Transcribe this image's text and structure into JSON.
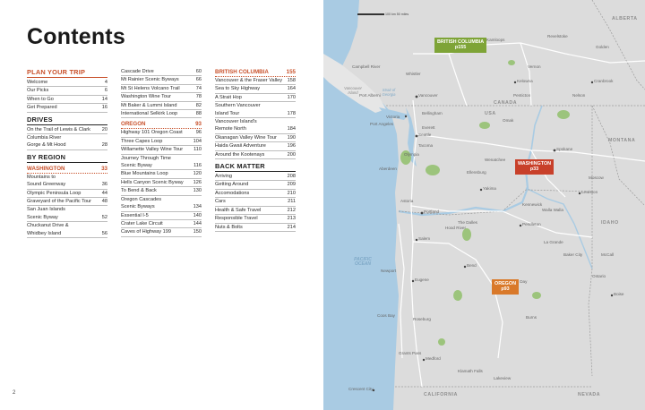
{
  "page_title": "Contents",
  "page_number": "2",
  "toc": {
    "col1": [
      {
        "kind": "section",
        "label": "PLAN YOUR TRIP",
        "page": ""
      },
      {
        "kind": "entry",
        "label": "Welcome",
        "page": "4"
      },
      {
        "kind": "entry",
        "label": "Our Picks",
        "page": "6"
      },
      {
        "kind": "entry",
        "label": "When to Go",
        "page": "14"
      },
      {
        "kind": "entry",
        "label": "Get Prepared",
        "page": "16"
      },
      {
        "kind": "section-dark",
        "label": "DRIVES",
        "page": ""
      },
      {
        "kind": "entry",
        "label": "On the Trail of Lewis & Clark",
        "page": "20"
      },
      {
        "kind": "wrap",
        "label": "Columbia River",
        "page": ""
      },
      {
        "kind": "entry",
        "label": "Gorge & Mt Hood",
        "page": "28"
      },
      {
        "kind": "section-dark",
        "label": "BY REGION",
        "page": ""
      },
      {
        "kind": "sub",
        "label": "WASHINGTON",
        "page": "33"
      },
      {
        "kind": "wrap",
        "label": "Mountains to",
        "page": ""
      },
      {
        "kind": "entry",
        "label": "Sound Greenway",
        "page": "36"
      },
      {
        "kind": "entry",
        "label": "Olympic Peninsula Loop",
        "page": "44"
      },
      {
        "kind": "entry",
        "label": "Graveyard of the Pacific Tour",
        "page": "48"
      },
      {
        "kind": "wrap",
        "label": "San Juan Islands",
        "page": ""
      },
      {
        "kind": "entry",
        "label": "Scenic Byway",
        "page": "52"
      },
      {
        "kind": "wrap",
        "label": "Chuckanut Drive &",
        "page": ""
      },
      {
        "kind": "entry",
        "label": "Whidbey Island",
        "page": "56"
      }
    ],
    "col2": [
      {
        "kind": "entry",
        "label": "Cascade Drive",
        "page": "60"
      },
      {
        "kind": "entry",
        "label": "Mt Rainier Scenic Byways",
        "page": "66"
      },
      {
        "kind": "entry",
        "label": "Mt St Helens Volcano Trail",
        "page": "74"
      },
      {
        "kind": "entry",
        "label": "Washington Wine Tour",
        "page": "78"
      },
      {
        "kind": "entry",
        "label": "Mt Baker & Lummi Island",
        "page": "82"
      },
      {
        "kind": "entry",
        "label": "International Selkirk Loop",
        "page": "88"
      },
      {
        "kind": "sub",
        "label": "OREGON",
        "page": "93"
      },
      {
        "kind": "entry",
        "label": "Highway 101 Oregon Coast",
        "page": "96"
      },
      {
        "kind": "entry",
        "label": "Three Capes Loop",
        "page": "104"
      },
      {
        "kind": "entry",
        "label": "Willamette Valley Wine Tour",
        "page": "110"
      },
      {
        "kind": "wrap",
        "label": "Journey Through Time",
        "page": ""
      },
      {
        "kind": "entry",
        "label": "Scenic Byway",
        "page": "116"
      },
      {
        "kind": "entry",
        "label": "Blue Mountains Loop",
        "page": "120"
      },
      {
        "kind": "entry",
        "label": "Hells Canyon Scenic Byway",
        "page": "126"
      },
      {
        "kind": "entry",
        "label": "To Bend & Back",
        "page": "130"
      },
      {
        "kind": "wrap",
        "label": "Oregon Cascades",
        "page": ""
      },
      {
        "kind": "entry",
        "label": "Scenic Byways",
        "page": "134"
      },
      {
        "kind": "entry",
        "label": "Essential I-5",
        "page": "140"
      },
      {
        "kind": "entry",
        "label": "Crater Lake Circuit",
        "page": "144"
      },
      {
        "kind": "entry",
        "label": "Caves of Highway 199",
        "page": "150"
      }
    ],
    "col3": [
      {
        "kind": "sub",
        "label": "BRITISH COLUMBIA",
        "page": "155"
      },
      {
        "kind": "entry",
        "label": "Vancouver & the Fraser Valley",
        "page": "158"
      },
      {
        "kind": "entry",
        "label": "Sea to Sky Highway",
        "page": "164"
      },
      {
        "kind": "entry",
        "label": "A Strait Hop",
        "page": "170"
      },
      {
        "kind": "wrap",
        "label": "Southern Vancouver",
        "page": ""
      },
      {
        "kind": "entry",
        "label": "Island Tour",
        "page": "178"
      },
      {
        "kind": "wrap",
        "label": "Vancouver Island's",
        "page": ""
      },
      {
        "kind": "entry",
        "label": "Remote North",
        "page": "184"
      },
      {
        "kind": "entry",
        "label": "Okanagan Valley Wine Tour",
        "page": "190"
      },
      {
        "kind": "entry",
        "label": "Haida Gwaii Adventure",
        "page": "196"
      },
      {
        "kind": "entry",
        "label": "Around the Kootenays",
        "page": "200"
      },
      {
        "kind": "section-dark",
        "label": "BACK MATTER",
        "page": ""
      },
      {
        "kind": "entry",
        "label": "Arriving",
        "page": "208"
      },
      {
        "kind": "entry",
        "label": "Getting Around",
        "page": "209"
      },
      {
        "kind": "entry",
        "label": "Accomodations",
        "page": "210"
      },
      {
        "kind": "entry",
        "label": "Cars",
        "page": "211"
      },
      {
        "kind": "entry",
        "label": "Health & Safe Travel",
        "page": "212"
      },
      {
        "kind": "entry",
        "label": "Responsible Travel",
        "page": "213"
      },
      {
        "kind": "entry",
        "label": "Nuts & Bolts",
        "page": "214"
      }
    ]
  },
  "map": {
    "scale": {
      "km": "100 km",
      "mi": "50 miles"
    },
    "badges": {
      "bc": {
        "name": "BRITISH COLUMBIA",
        "page": "p155"
      },
      "wa": {
        "name": "WASHINGTON",
        "page": "p33"
      },
      "or": {
        "name": "OREGON",
        "page": "p93"
      }
    },
    "regions": {
      "alberta": "ALBERTA",
      "montana": "MONTANA",
      "idaho": "IDAHO",
      "california": "CALIFORNIA",
      "nevada": "NEVADA",
      "canada": "CANADA",
      "usa": "USA"
    },
    "water": {
      "pacific": "PACIFIC\nOCEAN",
      "vancouver_island": "Vancouver\nIsland",
      "strait": "Strait of\nGeorgia"
    },
    "places": {
      "kamloops": "Kamloops",
      "kelowna": "Kelowna",
      "vancouver": "Vancouver",
      "victoria": "Victoria",
      "seattle": "Seattle",
      "spokane": "Spokane",
      "yakima": "Yakima",
      "portland": "Portland",
      "salem": "Salem",
      "eugene": "Eugene",
      "bend": "Bend",
      "medford": "Medford",
      "pendleton": "Pendleton",
      "lewiston": "Lewiston",
      "boise": "Boise",
      "cranbrook": "Cranbrook",
      "crescent_city": "Crescent City",
      "tacoma": "Tacoma",
      "olympia": "Olympia",
      "astoria": "Astoria",
      "newport": "Newport",
      "coos_bay": "Coos Bay",
      "klamath_falls": "Klamath Falls",
      "burns": "Burns",
      "walla_walla": "Walla Walla",
      "wenatchee": "Wenatchee",
      "kennewick": "Kennewick",
      "campbell_river": "Campbell River",
      "port_hardy": "Port Alberni",
      "nelson": "Nelson",
      "revelstoke": "Revelstoke",
      "vernon": "Vernon",
      "penticton": "Penticton",
      "bellingham": "Bellingham",
      "everett": "Everett",
      "whistler": "Whistler",
      "ellensburg": "Ellensburg",
      "omak": "Omak",
      "baker_city": "Baker City",
      "la_grande": "La Grande",
      "john_day": "John Day",
      "ontario": "Ontario",
      "roseburg": "Roseburg",
      "grants_pass": "Grants Pass",
      "the_dalles": "The Dalles",
      "hood_river": "Hood River",
      "aberdeen": "Aberdeen",
      "port_angeles": "Port Angeles",
      "lakeview": "Lakeview",
      "moscow": "Moscow",
      "mccall": "McCall",
      "golden": "Golden"
    }
  },
  "colors": {
    "accent": "#c8502a",
    "bc_badge": "#7ea437",
    "wa_badge": "#c8402a",
    "or_badge": "#d9792a",
    "water": "#a9cbe3",
    "park": "#9cc47c"
  }
}
